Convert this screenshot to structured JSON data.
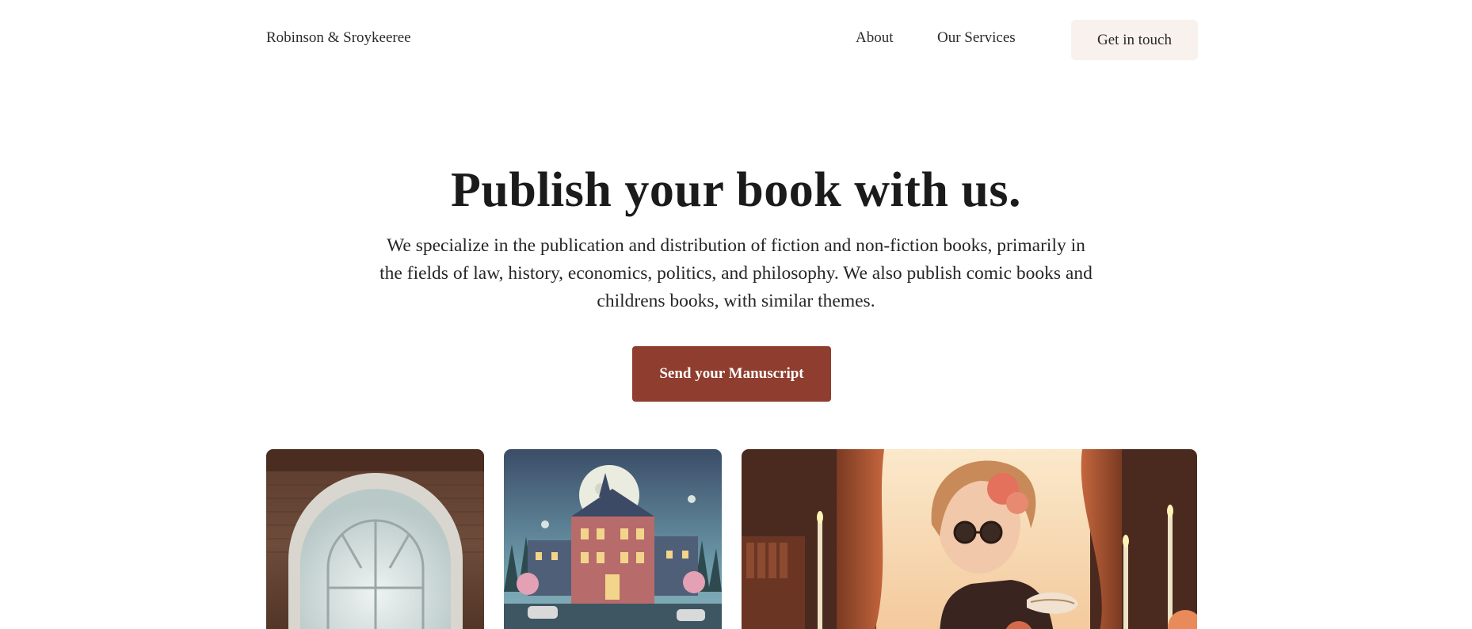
{
  "nav": {
    "brand": "Robinson & Sroykeeree",
    "links": [
      {
        "label": "About"
      },
      {
        "label": "Our Services"
      }
    ],
    "cta_label": "Get in touch"
  },
  "hero": {
    "title": "Publish your book with us.",
    "subtitle": "We specialize in the publication and distribution of fiction and non-fiction books, primarily in the fields of law, history, economics, politics, and philosophy. We also publish comic books and childrens books, with similar themes.",
    "button_label": "Send your Manuscript"
  },
  "gallery": [
    {
      "icon": "arched-window-illustration"
    },
    {
      "icon": "moonlit-mansion-illustration"
    },
    {
      "icon": "woman-with-teacup-illustration"
    }
  ],
  "colors": {
    "accent": "#8e3d2e",
    "cta_background": "#f8f1ee",
    "text": "#1d1d1d"
  }
}
